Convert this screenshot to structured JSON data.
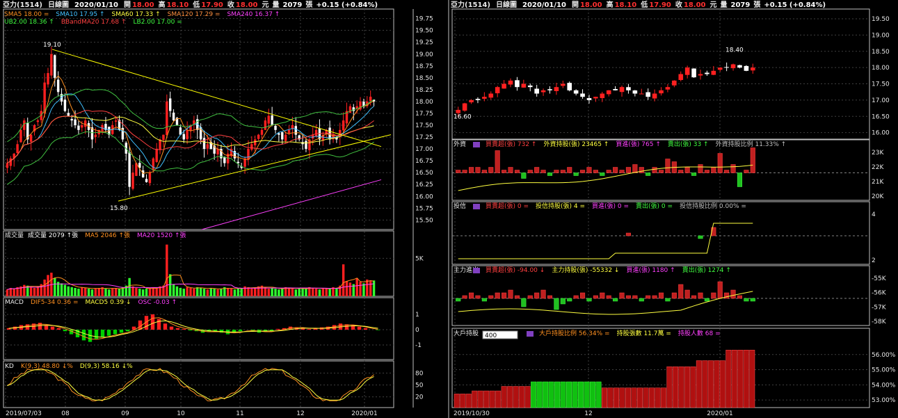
{
  "colors": {
    "up": "#ff2020",
    "down": "#00d000",
    "grid": "#404040",
    "frame": "#c0c0c0",
    "yellow": "#ffff00",
    "text": "#e8e8e8"
  },
  "left": {
    "title": "亞力(1514)",
    "freq": "日線圖",
    "date": "2020/01/10",
    "open_label": "開",
    "open": "18.00",
    "high_label": "高",
    "high": "18.10",
    "low_label": "低",
    "low": "17.90",
    "close_label": "收",
    "close": "18.00",
    "unit": "元",
    "vol_label": "量",
    "volume": "2079",
    "vol_unit": "張",
    "change": "+0.15 (+0.84%)",
    "ma_items": [
      {
        "text": "SMA5 18.00 =",
        "color": "#ff9020"
      },
      {
        "text": "SMA10 17.95 ↑",
        "color": "#40c0ff"
      },
      {
        "text": "SMA60 17.33 ↑",
        "color": "#ffff40"
      },
      {
        "text": "SMA120 17.29 =",
        "color": "#ff9040"
      },
      {
        "text": "SMA240 16.37 ↑",
        "color": "#ff40ff"
      }
    ],
    "bb_items": [
      {
        "text": "UB2.00 18.36 ↑",
        "color": "#40ff40"
      },
      {
        "text": "BBandMA20 17.68 ↑",
        "color": "#ff4040"
      },
      {
        "text": "LB2.00 17.00 =",
        "color": "#40ff40"
      }
    ],
    "high_annot": "19.10",
    "low_annot": "15.80",
    "price_ticks": [
      "19.75",
      "19.50",
      "19.25",
      "19.00",
      "18.75",
      "18.50",
      "18.25",
      "18.00",
      "17.75",
      "17.50",
      "17.25",
      "17.00",
      "16.75",
      "16.50",
      "16.25",
      "16.00",
      "15.75",
      "15.50"
    ],
    "vol_title": "成交量",
    "vol_items": [
      {
        "text": "成交量 2079 ↑張",
        "color": "#ffffff"
      },
      {
        "text": "MA5 2046 ↑張",
        "color": "#ff9020"
      },
      {
        "text": "MA20 1520 ↑張",
        "color": "#ff40ff"
      }
    ],
    "vol_tick": "5K",
    "macd_title": "MACD",
    "macd_items": [
      {
        "text": "DIF5-34 0.36 =",
        "color": "#ff9020"
      },
      {
        "text": "MACD5 0.39 ↓",
        "color": "#ffff40"
      },
      {
        "text": "OSC -0.03 ↑",
        "color": "#ff40ff"
      }
    ],
    "macd_ticks": [
      "1",
      "0",
      "-1"
    ],
    "kd_title": "KD",
    "kd_items": [
      {
        "text": "K(9,3) 48.80 ↓%",
        "color": "#ff9020"
      },
      {
        "text": "D(9,3) 58.16 ↓%",
        "color": "#ffff40"
      }
    ],
    "kd_ticks": [
      "80",
      "50",
      "20"
    ],
    "x_ticks": [
      "2019/07/03",
      "08",
      "09",
      "10",
      "11",
      "12",
      "2020/01"
    ]
  },
  "right": {
    "title": "亞力(1514)",
    "freq": "日線圖",
    "date": "2020/01/10",
    "open_label": "開",
    "open": "18.00",
    "high_label": "高",
    "high": "18.10",
    "low_label": "低",
    "low": "17.90",
    "close_label": "收",
    "close": "18.00",
    "unit": "元",
    "vol_label": "量",
    "volume": "2079",
    "vol_unit": "張",
    "change": "+0.15 (+0.84%)",
    "high_annot": "18.40",
    "low_annot": "16.60",
    "price_ticks": [
      "19.50",
      "19.00",
      "18.50",
      "18.00",
      "17.50",
      "17.00",
      "16.50",
      "16.00"
    ],
    "foreign_title": "外資",
    "foreign_items": [
      {
        "text": "買賣超(張) 732 ↑",
        "color": "#ff4040"
      },
      {
        "text": "外資持股(張) 23465 ↑",
        "color": "#ffff40"
      },
      {
        "text": "買進(張) 765 ↑",
        "color": "#ff40ff"
      },
      {
        "text": "賣出(張) 33 ↑",
        "color": "#40ff40"
      },
      {
        "text": "外資持股比例 11.33% ↑",
        "color": "#c0c0c0"
      }
    ],
    "foreign_ticks": [
      "23K",
      "22K",
      "21K",
      "20K"
    ],
    "trust_title": "投信",
    "trust_items": [
      {
        "text": "買賣超(張) 0 =",
        "color": "#ff4040"
      },
      {
        "text": "投信持股(張) 4 =",
        "color": "#ffff40"
      },
      {
        "text": "買進(張) 0 =",
        "color": "#ff40ff"
      },
      {
        "text": "賣出(張) 0 =",
        "color": "#40ff40"
      },
      {
        "text": "投信持股比例 0.00% =",
        "color": "#c0c0c0"
      }
    ],
    "trust_ticks": [
      "4",
      "2"
    ],
    "main_title": "主力進出",
    "main_items": [
      {
        "text": "買賣超(張) -94.00 ↓",
        "color": "#ff4040"
      },
      {
        "text": "主力持股(張) -55332 ↓",
        "color": "#ffff40"
      },
      {
        "text": "買進(張) 1180 ↑",
        "color": "#ff40ff"
      },
      {
        "text": "賣出(張) 1274 ↑",
        "color": "#40ff40"
      }
    ],
    "main_ticks": [
      "-55K",
      "-56K",
      "-57K",
      "-58K"
    ],
    "big_title": "大戶持股",
    "big_select": "400",
    "big_items": [
      {
        "text": "大戶持股比例 56.34% =",
        "color": "#ff9020"
      },
      {
        "text": "持股張數 11.7萬 =",
        "color": "#ffff40"
      },
      {
        "text": "持股人數 68 =",
        "color": "#ff40ff"
      }
    ],
    "big_ticks": [
      "56.00%",
      "55.00%",
      "54.00%",
      "53.00%"
    ],
    "x_ticks": [
      "2019/10/30",
      "12",
      "2020/01"
    ]
  },
  "chart_data": [
    {
      "type": "candlestick",
      "name": "left-daily",
      "ylim": [
        15.3,
        19.95
      ],
      "grid": true,
      "close": [
        16.7,
        16.8,
        16.9,
        17.1,
        17.4,
        17.6,
        17.2,
        17.3,
        17.5,
        17.6,
        17.8,
        18.4,
        18.6,
        19.0,
        18.5,
        18.2,
        18.0,
        17.8,
        17.7,
        17.6,
        17.5,
        17.4,
        17.5,
        17.6,
        17.4,
        17.2,
        17.3,
        17.4,
        17.5,
        17.4,
        17.3,
        17.5,
        17.6,
        17.4,
        17.2,
        16.9,
        16.2,
        16.5,
        16.7,
        16.6,
        16.4,
        16.3,
        16.5,
        16.8,
        17.0,
        17.2,
        17.3,
        18.0,
        17.8,
        17.6,
        17.5,
        17.3,
        17.2,
        17.4,
        17.5,
        17.6,
        17.4,
        17.2,
        17.0,
        17.1,
        17.0,
        16.9,
        17.0,
        16.8,
        16.7,
        16.9,
        17.0,
        16.8,
        16.7,
        16.6,
        16.8,
        17.0,
        17.1,
        17.2,
        17.3,
        17.4,
        17.6,
        17.7,
        17.5,
        17.4,
        17.3,
        17.2,
        17.3,
        17.4,
        17.5,
        17.3,
        17.2,
        17.1,
        17.0,
        17.2,
        17.3,
        17.4,
        17.2,
        17.3,
        17.4,
        17.2,
        17.3,
        17.2,
        17.4,
        17.6,
        17.8,
        17.9,
        17.8,
        17.9,
        18.0,
        17.9,
        18.0,
        18.1,
        18.0
      ]
    },
    {
      "type": "bar",
      "name": "left-volume",
      "values": [
        0.9,
        1.1,
        1.0,
        1.2,
        1.3,
        1.5,
        1.4,
        1.2,
        1.1,
        1.3,
        1.6,
        2.2,
        2.8,
        3.1,
        2.4,
        1.9,
        1.7,
        1.5,
        1.3,
        1.2,
        1.1,
        1.0,
        1.2,
        1.1,
        1.0,
        0.9,
        1.0,
        1.1,
        1.2,
        1.0,
        0.9,
        1.0,
        1.1,
        1.0,
        1.2,
        1.4,
        2.4,
        1.3,
        1.1,
        1.0,
        0.9,
        1.0,
        1.1,
        1.2,
        1.1,
        1.3,
        1.4,
        6.8,
        2.9,
        1.6,
        1.3,
        1.1,
        1.0,
        1.2,
        1.1,
        1.0,
        1.2,
        1.1,
        1.0,
        0.9,
        1.1,
        1.0,
        0.9,
        1.0,
        1.2,
        1.1,
        1.0,
        0.9,
        1.0,
        1.1,
        1.3,
        1.2,
        1.0,
        1.1,
        1.3,
        1.4,
        1.2,
        1.0,
        1.1,
        1.0,
        0.9,
        1.0,
        1.2,
        1.1,
        1.0,
        0.9,
        1.0,
        1.1,
        1.0,
        1.2,
        1.1,
        1.0,
        0.9,
        1.0,
        1.1,
        1.0,
        1.2,
        1.1,
        1.4,
        4.2,
        2.0,
        1.8,
        1.6,
        2.4,
        1.9,
        1.7,
        2.2,
        2.1,
        2.08
      ]
    },
    {
      "type": "bar",
      "name": "left-macd-osc",
      "values": [
        0.1,
        0.2,
        0.3,
        0.35,
        0.4,
        0.45,
        0.3,
        0.2,
        0.1,
        -0.1,
        -0.3,
        -0.5,
        -0.7,
        -0.8,
        -0.6,
        -0.5,
        -0.4,
        -0.3,
        -0.2,
        -0.1,
        0.2,
        0.6,
        0.9,
        1.0,
        0.7,
        0.4,
        0.2,
        0.1,
        0.05,
        -0.05,
        -0.1,
        -0.2,
        -0.15,
        -0.1,
        -0.2,
        -0.3,
        -0.2,
        -0.1,
        0.0,
        -0.1,
        -0.2,
        -0.15,
        -0.1,
        0.05,
        0.1,
        0.2,
        0.15,
        0.1,
        0.05,
        0.1,
        0.15,
        0.2,
        0.3,
        0.4,
        0.35,
        0.3,
        0.2,
        0.1,
        0.0,
        -0.03
      ]
    },
    {
      "type": "candlestick",
      "name": "right-daily",
      "ylim": [
        15.8,
        19.8
      ],
      "grid": true,
      "close": [
        16.7,
        16.9,
        17.0,
        17.0,
        17.1,
        17.2,
        17.4,
        17.5,
        17.6,
        17.4,
        17.5,
        17.4,
        17.2,
        17.3,
        17.3,
        17.4,
        17.5,
        17.3,
        17.2,
        17.1,
        17.0,
        17.1,
        17.2,
        17.3,
        17.3,
        17.4,
        17.3,
        17.2,
        17.2,
        17.1,
        17.2,
        17.3,
        17.4,
        17.6,
        17.8,
        18.0,
        17.7,
        17.8,
        17.8,
        17.9,
        18.0,
        18.0,
        18.1,
        18.0,
        17.9,
        18.0
      ]
    },
    {
      "type": "bar",
      "name": "right-foreign-net",
      "values": [
        1,
        1,
        2,
        2,
        1,
        2,
        8,
        1,
        2,
        1,
        -2,
        1,
        2,
        1,
        -1,
        1,
        1,
        2,
        -1,
        1,
        2,
        1,
        -1,
        1,
        2,
        1,
        2,
        3,
        2,
        -1,
        2,
        1,
        5,
        4,
        1,
        2,
        -1,
        3,
        1,
        2,
        7,
        1,
        3,
        -5,
        1,
        9
      ]
    },
    {
      "type": "bar",
      "name": "right-trust-net",
      "values": [
        0,
        0,
        0,
        0,
        0,
        0,
        0,
        0,
        0,
        0,
        0,
        0,
        0,
        0,
        0,
        0,
        0,
        0,
        0,
        0,
        0,
        0,
        0,
        0,
        0,
        0,
        1,
        0,
        0,
        0,
        0,
        0,
        0,
        0,
        0,
        0,
        0,
        -1,
        0,
        3,
        0,
        0,
        0,
        0,
        0,
        0
      ]
    },
    {
      "type": "bar",
      "name": "right-main-net",
      "values": [
        -1,
        1,
        2,
        1,
        -1,
        1,
        2,
        2,
        3,
        1,
        -3,
        1,
        2,
        3,
        1,
        -4,
        -2,
        -1,
        1,
        2,
        -1,
        1,
        2,
        1,
        -1,
        2,
        1,
        1,
        -1,
        1,
        1,
        2,
        -1,
        2,
        5,
        3,
        1,
        2,
        -1,
        2,
        6,
        2,
        3,
        1,
        -1,
        -1
      ]
    },
    {
      "type": "bar",
      "name": "right-big-holder",
      "ylim": [
        52.5,
        57
      ],
      "values": [
        53.4,
        53.4,
        53.4,
        53.6,
        53.6,
        53.6,
        53.6,
        53.6,
        53.9,
        53.9,
        53.9,
        53.9,
        53.9,
        54.2,
        54.2,
        54.2,
        54.2,
        54.2,
        54.2,
        54.2,
        54.2,
        54.2,
        54.2,
        54.2,
        54.2,
        53.8,
        53.8,
        53.8,
        53.8,
        53.8,
        53.8,
        53.8,
        53.8,
        53.8,
        53.8,
        53.8,
        55.2,
        55.2,
        55.2,
        55.2,
        55.2,
        55.6,
        55.6,
        55.6,
        55.6,
        55.6,
        56.3,
        56.3,
        56.3,
        56.3,
        56.3
      ]
    }
  ]
}
